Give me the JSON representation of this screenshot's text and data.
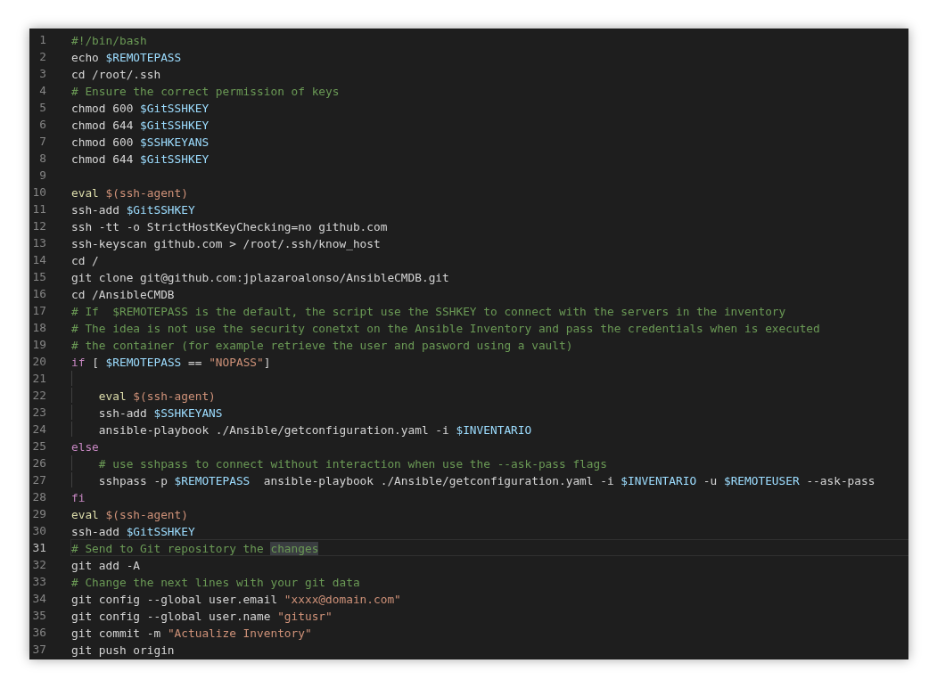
{
  "editor": {
    "lines": [
      {
        "number": "1",
        "current": false,
        "tokens": [
          {
            "text": "#!/bin/bash",
            "kind": "comment"
          }
        ]
      },
      {
        "number": "2",
        "current": false,
        "tokens": [
          {
            "text": "echo ",
            "kind": "plain"
          },
          {
            "text": "$REMOTEPASS",
            "kind": "variable"
          }
        ]
      },
      {
        "number": "3",
        "current": false,
        "tokens": [
          {
            "text": "cd /root/.ssh",
            "kind": "plain"
          }
        ]
      },
      {
        "number": "4",
        "current": false,
        "tokens": [
          {
            "text": "# Ensure the correct permission of keys",
            "kind": "comment"
          }
        ]
      },
      {
        "number": "5",
        "current": false,
        "tokens": [
          {
            "text": "chmod 600 ",
            "kind": "plain"
          },
          {
            "text": "$GitSSHKEY",
            "kind": "variable"
          }
        ]
      },
      {
        "number": "6",
        "current": false,
        "tokens": [
          {
            "text": "chmod 644 ",
            "kind": "plain"
          },
          {
            "text": "$GitSSHKEY",
            "kind": "variable"
          }
        ]
      },
      {
        "number": "7",
        "current": false,
        "tokens": [
          {
            "text": "chmod 600 ",
            "kind": "plain"
          },
          {
            "text": "$SSHKEYANS",
            "kind": "variable"
          }
        ]
      },
      {
        "number": "8",
        "current": false,
        "tokens": [
          {
            "text": "chmod 644 ",
            "kind": "plain"
          },
          {
            "text": "$GitSSHKEY",
            "kind": "variable"
          }
        ]
      },
      {
        "number": "9",
        "current": false
      },
      {
        "number": "10",
        "current": false,
        "tokens": [
          {
            "text": "eval ",
            "kind": "builtin"
          },
          {
            "text": "$(ssh-agent)",
            "kind": "string"
          }
        ]
      },
      {
        "number": "11",
        "current": false,
        "tokens": [
          {
            "text": "ssh-add ",
            "kind": "plain"
          },
          {
            "text": "$GitSSHKEY",
            "kind": "variable"
          }
        ]
      },
      {
        "number": "12",
        "current": false,
        "tokens": [
          {
            "text": "ssh -tt -o StrictHostKeyChecking=no github.com",
            "kind": "plain"
          }
        ]
      },
      {
        "number": "13",
        "current": false,
        "tokens": [
          {
            "text": "ssh-keyscan github.com > /root/.ssh/know_host",
            "kind": "plain"
          }
        ]
      },
      {
        "number": "14",
        "current": false,
        "tokens": [
          {
            "text": "cd /",
            "kind": "plain"
          }
        ]
      },
      {
        "number": "15",
        "current": false,
        "tokens": [
          {
            "text": "git clone git@github.com:jplazaroalonso/AnsibleCMDB.git",
            "kind": "plain"
          }
        ]
      },
      {
        "number": "16",
        "current": false,
        "tokens": [
          {
            "text": "cd /AnsibleCMDB",
            "kind": "plain"
          }
        ]
      },
      {
        "number": "17",
        "current": false,
        "tokens": [
          {
            "text": "# If  $REMOTEPASS is the default, the script use the SSHKEY to connect with the servers in the inventory",
            "kind": "comment"
          }
        ]
      },
      {
        "number": "18",
        "current": false,
        "tokens": [
          {
            "text": "# The idea is not use the security conetxt on the Ansible Inventory and pass the credentials when is executed",
            "kind": "comment"
          }
        ]
      },
      {
        "number": "19",
        "current": false,
        "tokens": [
          {
            "text": "# the container (for example retrieve the user and pasword using a vault)",
            "kind": "comment"
          }
        ]
      },
      {
        "number": "20",
        "current": false,
        "tokens": [
          {
            "text": "if",
            "kind": "keyword"
          },
          {
            "text": " [ ",
            "kind": "plain"
          },
          {
            "text": "$REMOTEPASS",
            "kind": "variable"
          },
          {
            "text": " == ",
            "kind": "plain"
          },
          {
            "text": "\"NOPASS\"",
            "kind": "string"
          },
          {
            "text": "]",
            "kind": "plain"
          }
        ],
        "children": [
          {
            "number": "21",
            "current": false
          },
          {
            "number": "22",
            "current": false,
            "tokens": [
              {
                "text": "eval ",
                "kind": "builtin"
              },
              {
                "text": "$(ssh-agent)",
                "kind": "string"
              }
            ]
          },
          {
            "number": "23",
            "current": false,
            "tokens": [
              {
                "text": "ssh-add ",
                "kind": "plain"
              },
              {
                "text": "$SSHKEYANS",
                "kind": "variable"
              }
            ]
          },
          {
            "number": "24",
            "current": false,
            "tokens": [
              {
                "text": "ansible-playbook ./Ansible/getconfiguration.yaml -i ",
                "kind": "plain"
              },
              {
                "text": "$INVENTARIO",
                "kind": "variable"
              }
            ]
          }
        ]
      },
      {
        "number": "25",
        "current": false,
        "tokens": [
          {
            "text": "else",
            "kind": "keyword"
          }
        ],
        "children": [
          {
            "number": "26",
            "current": false,
            "tokens": [
              {
                "text": "# use sshpass to connect without interaction when use the --ask-pass flags",
                "kind": "comment"
              }
            ]
          },
          {
            "number": "27",
            "current": false,
            "tokens": [
              {
                "text": "sshpass -p ",
                "kind": "plain"
              },
              {
                "text": "$REMOTEPASS",
                "kind": "variable"
              },
              {
                "text": "  ansible-playbook ./Ansible/getconfiguration.yaml -i ",
                "kind": "plain"
              },
              {
                "text": "$INVENTARIO",
                "kind": "variable"
              },
              {
                "text": " -u ",
                "kind": "plain"
              },
              {
                "text": "$REMOTEUSER",
                "kind": "variable"
              },
              {
                "text": " --ask-pass",
                "kind": "plain"
              }
            ]
          }
        ]
      },
      {
        "number": "28",
        "current": false,
        "tokens": [
          {
            "text": "fi",
            "kind": "keyword"
          }
        ]
      },
      {
        "number": "29",
        "current": false,
        "tokens": [
          {
            "text": "eval ",
            "kind": "builtin"
          },
          {
            "text": "$(ssh-agent)",
            "kind": "string"
          }
        ]
      },
      {
        "number": "30",
        "current": false,
        "tokens": [
          {
            "text": "ssh-add ",
            "kind": "plain"
          },
          {
            "text": "$GitSSHKEY",
            "kind": "variable"
          }
        ]
      },
      {
        "number": "31",
        "current": true,
        "tokens": [
          {
            "text": "# Send to Git repository the ",
            "kind": "comment"
          },
          {
            "text": "changes",
            "kind": "comment",
            "highlighted": true
          }
        ]
      },
      {
        "number": "32",
        "current": false,
        "tokens": [
          {
            "text": "git add -A",
            "kind": "plain"
          }
        ]
      },
      {
        "number": "33",
        "current": false,
        "tokens": [
          {
            "text": "# Change the next lines with your git data",
            "kind": "comment"
          }
        ]
      },
      {
        "number": "34",
        "current": false,
        "tokens": [
          {
            "text": "git config --global user.email ",
            "kind": "plain"
          },
          {
            "text": "\"xxxx@domain.com\"",
            "kind": "string"
          }
        ]
      },
      {
        "number": "35",
        "current": false,
        "tokens": [
          {
            "text": "git config --global user.name ",
            "kind": "plain"
          },
          {
            "text": "\"gitusr\"",
            "kind": "string"
          }
        ]
      },
      {
        "number": "36",
        "current": false,
        "tokens": [
          {
            "text": "git commit -m ",
            "kind": "plain"
          },
          {
            "text": "\"Actualize Inventory\"",
            "kind": "string"
          }
        ]
      },
      {
        "number": "37",
        "current": false,
        "tokens": [
          {
            "text": "git push origin",
            "kind": "plain"
          }
        ]
      }
    ]
  }
}
